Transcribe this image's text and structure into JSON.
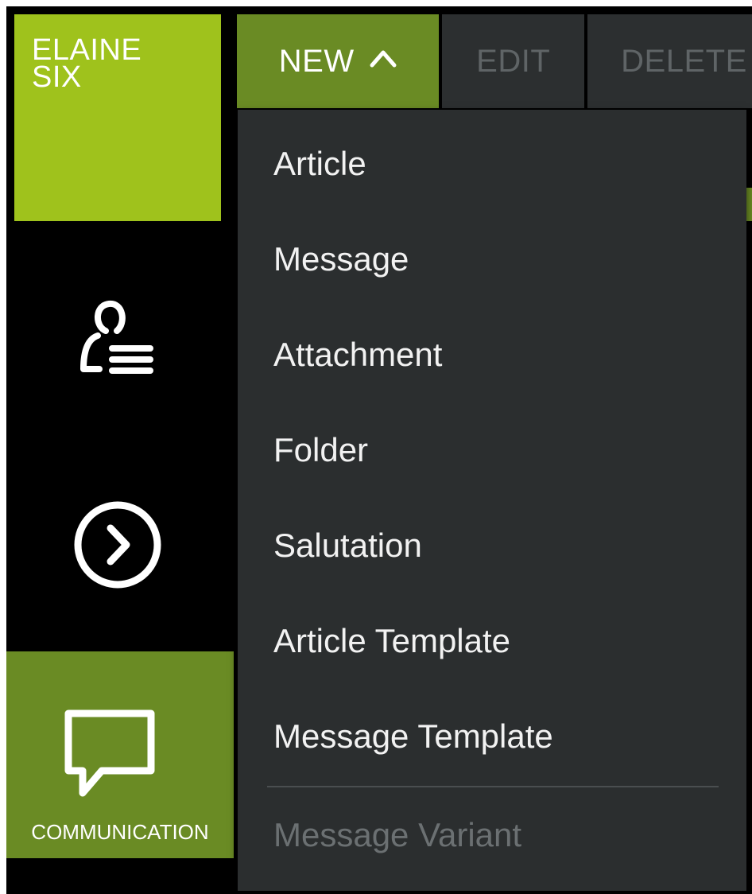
{
  "user": {
    "name": "ELAINE\nSIX"
  },
  "rail": {
    "contacts_icon": "contact-list-icon",
    "forward_icon": "chevron-right-circle-icon",
    "communication": {
      "icon": "speech-bubble-icon",
      "label": "COMMUNICATION"
    }
  },
  "toolbar": {
    "new_label": "NEW",
    "new_caret_icon": "chevron-up-icon",
    "edit_label": "EDIT",
    "delete_label": "DELETE"
  },
  "menu": {
    "items": [
      {
        "label": "Article",
        "enabled": true
      },
      {
        "label": "Message",
        "enabled": true
      },
      {
        "label": "Attachment",
        "enabled": true
      },
      {
        "label": "Folder",
        "enabled": true
      },
      {
        "label": "Salutation",
        "enabled": true
      },
      {
        "label": "Article Template",
        "enabled": true
      },
      {
        "label": "Message Template",
        "enabled": true
      },
      {
        "label": "Message Variant",
        "enabled": false
      }
    ]
  },
  "colors": {
    "user_tile": "#9fc21c",
    "active_green": "#6a8b24",
    "toolbar_inactive": "#2c2f30",
    "menu_bg": "#2b2e2f",
    "disabled_text": "#6b7072"
  }
}
